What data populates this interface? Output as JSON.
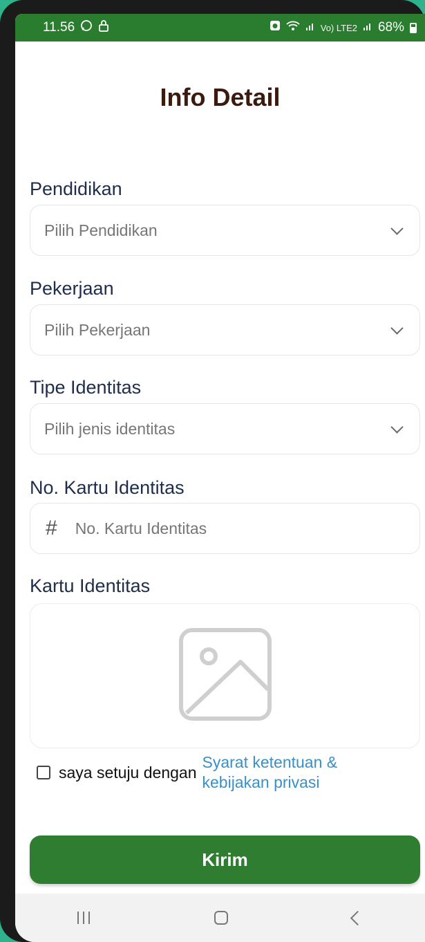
{
  "status_bar": {
    "time": "11.56",
    "network": "Vo) LTE2",
    "battery": "68%"
  },
  "page": {
    "title": "Info Detail"
  },
  "form": {
    "education": {
      "label": "Pendidikan",
      "placeholder": "Pilih Pendidikan"
    },
    "occupation": {
      "label": "Pekerjaan",
      "placeholder": "Pilih Pekerjaan"
    },
    "identity_type": {
      "label": "Tipe Identitas",
      "placeholder": "Pilih jenis identitas"
    },
    "identity_number": {
      "label": "No. Kartu Identitas",
      "placeholder": "No. Kartu Identitas",
      "icon": "#"
    },
    "identity_card": {
      "label": "Kartu Identitas"
    }
  },
  "consent": {
    "text": "saya setuju dengan",
    "link": "Syarat ketentuan & kebijakan privasi",
    "checked": false
  },
  "submit": {
    "label": "Kirim"
  },
  "colors": {
    "primary": "#2f7d31",
    "status_bar": "#2a7d2e",
    "link": "#3a8fc8",
    "title": "#3b1b10",
    "label": "#1f2d4d"
  }
}
